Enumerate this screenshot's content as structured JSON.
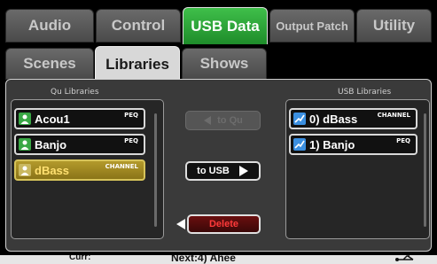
{
  "tabs_row1": [
    {
      "label": "Audio"
    },
    {
      "label": "Control"
    },
    {
      "label": "USB Data"
    },
    {
      "label": "Output Patch"
    },
    {
      "label": "Utility"
    }
  ],
  "tabs_row2": [
    {
      "label": "Scenes"
    },
    {
      "label": "Libraries"
    },
    {
      "label": "Shows"
    }
  ],
  "qu_libraries": {
    "title": "Qu Libraries",
    "items": [
      {
        "name": "Acou1",
        "type": "PEQ",
        "icon": "person-icon"
      },
      {
        "name": "Banjo",
        "type": "PEQ",
        "icon": "person-icon"
      },
      {
        "name": "dBass",
        "type": "CHANNEL",
        "icon": "person-icon",
        "selected": true
      }
    ]
  },
  "usb_libraries": {
    "title": "USB Libraries",
    "items": [
      {
        "name": "0) dBass",
        "type": "CHANNEL",
        "icon": "eq-icon"
      },
      {
        "name": "1) Banjo",
        "type": "PEQ",
        "icon": "eq-icon"
      }
    ]
  },
  "buttons": {
    "to_qu": "to Qu",
    "to_usb": "to USB",
    "delete": "Delete"
  },
  "status": {
    "curr": "Curr:",
    "next": "Next:4) Ahee"
  },
  "colors": {
    "active_tab": "#2aa836",
    "selected_item": "#b39a2c",
    "delete_text": "#ff3a3a"
  }
}
